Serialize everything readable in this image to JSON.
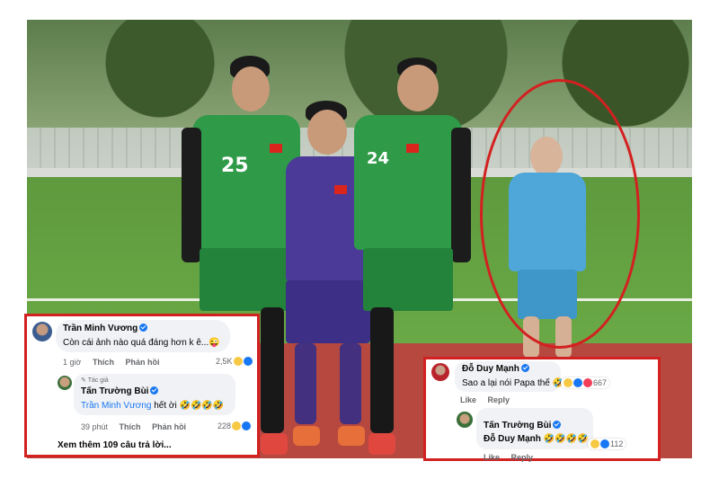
{
  "left_box": {
    "comment1": {
      "author": "Trần Minh Vương",
      "text": "Còn cái ảnh nào quá đáng hơn k ê...😜",
      "time": "1 giờ",
      "like": "Thích",
      "reply": "Phản hồi",
      "reaction_count": "2,5K"
    },
    "reply1": {
      "badge": "Tác giả",
      "author": "Tấn Trường Bùi",
      "mention": "Trần Minh Vương",
      "text": "hết ời 🤣🤣🤣🤣",
      "time": "39 phút",
      "like": "Thích",
      "reply": "Phản hồi",
      "reaction_count": "228"
    },
    "more_replies": "Xem thêm 109 câu trả lời..."
  },
  "right_box": {
    "comment1": {
      "author": "Đỗ Duy Mạnh",
      "text": "Sao a lại nói Papa thế 🤣",
      "reaction_count": "667",
      "like": "Like",
      "reply": "Reply"
    },
    "reply1": {
      "author": "Tấn Trường Bùi",
      "mention": "Đỗ Duy Mạnh",
      "text": "🤣🤣🤣🤣",
      "reaction_count": "112",
      "like": "Like",
      "reply": "Reply"
    }
  },
  "photo": {
    "jersey_numbers": [
      "25",
      "24"
    ]
  },
  "colors": {
    "highlight_red": "#d32020",
    "facebook_blue": "#1877f2",
    "bubble_bg": "#f0f2f5"
  }
}
